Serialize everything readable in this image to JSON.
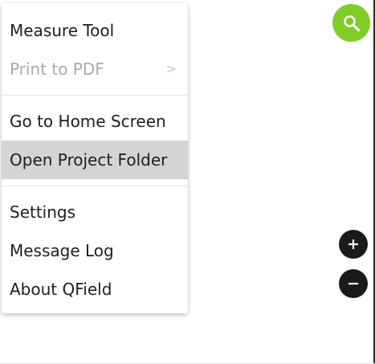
{
  "menu": {
    "items": [
      {
        "label": "Measure Tool",
        "enabled": true
      },
      {
        "label": "Print to PDF",
        "enabled": false,
        "submenu_indicator": ">"
      },
      {
        "label": "Go to Home Screen",
        "enabled": true
      },
      {
        "label": "Open Project Folder",
        "enabled": true,
        "highlighted": true
      },
      {
        "label": "Settings",
        "enabled": true
      },
      {
        "label": "Message Log",
        "enabled": true
      },
      {
        "label": "About QField",
        "enabled": true
      }
    ]
  },
  "map_controls": {
    "search_icon": "search-icon",
    "zoom_in_icon": "plus-icon",
    "zoom_out_icon": "minus-icon"
  },
  "colors": {
    "search_button": "#80cc28",
    "zoom_buttons": "#1a1a1a",
    "highlight": "#d4d4d4",
    "disabled_text": "#a9a9a9"
  }
}
